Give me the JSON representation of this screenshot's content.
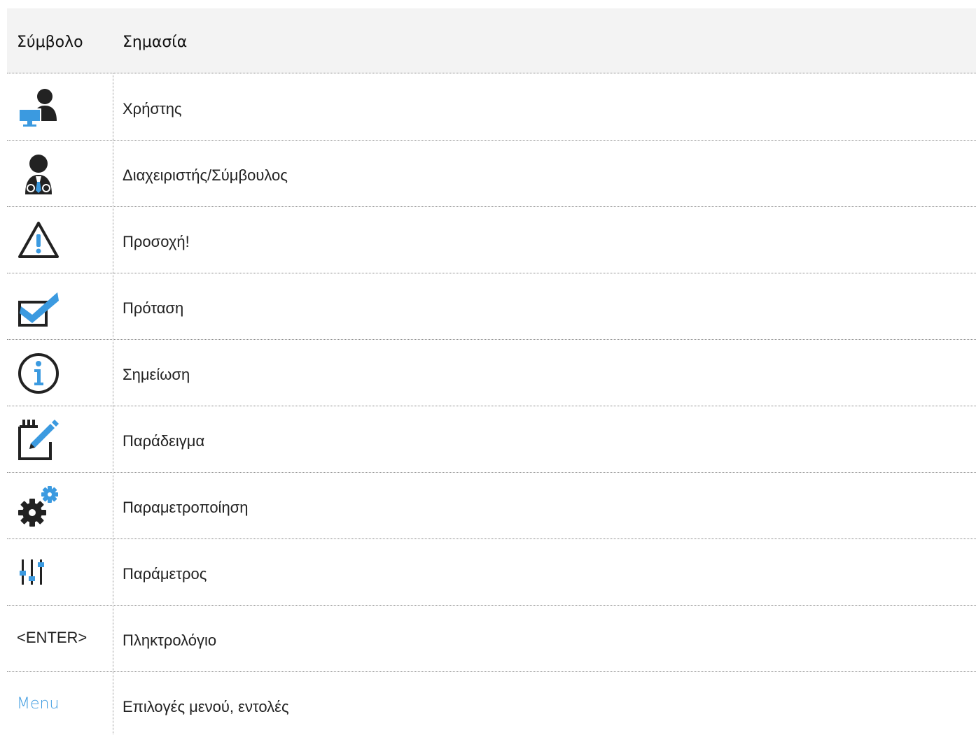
{
  "header": {
    "symbol": "Σύμβολο",
    "meaning": "Σημασία"
  },
  "rows": [
    {
      "icon": "user-computer-icon",
      "meaning": "Χρήστης"
    },
    {
      "icon": "administrator-consultant-icon",
      "meaning": "Διαχειριστής/Σύμβουλος"
    },
    {
      "icon": "warning-triangle-icon",
      "meaning": "Προσοχή!"
    },
    {
      "icon": "checkbox-check-icon",
      "meaning": "Πρόταση"
    },
    {
      "icon": "info-circle-icon",
      "meaning": "Σημείωση"
    },
    {
      "icon": "notepad-pencil-icon",
      "meaning": "Παράδειγμα"
    },
    {
      "icon": "gears-icon",
      "meaning": "Παραμετροποίηση"
    },
    {
      "icon": "sliders-icon",
      "meaning": "Παράμετρος"
    },
    {
      "symbol_text": "<ENTER>",
      "meaning": "Πληκτρολόγιο"
    },
    {
      "symbol_text": "Menu",
      "meaning": "Επιλογές μενού, εντολές"
    }
  ],
  "colors": {
    "icon_dark": "#222222",
    "icon_blue": "#3b9ae0",
    "header_bg": "#f3f3f3"
  }
}
